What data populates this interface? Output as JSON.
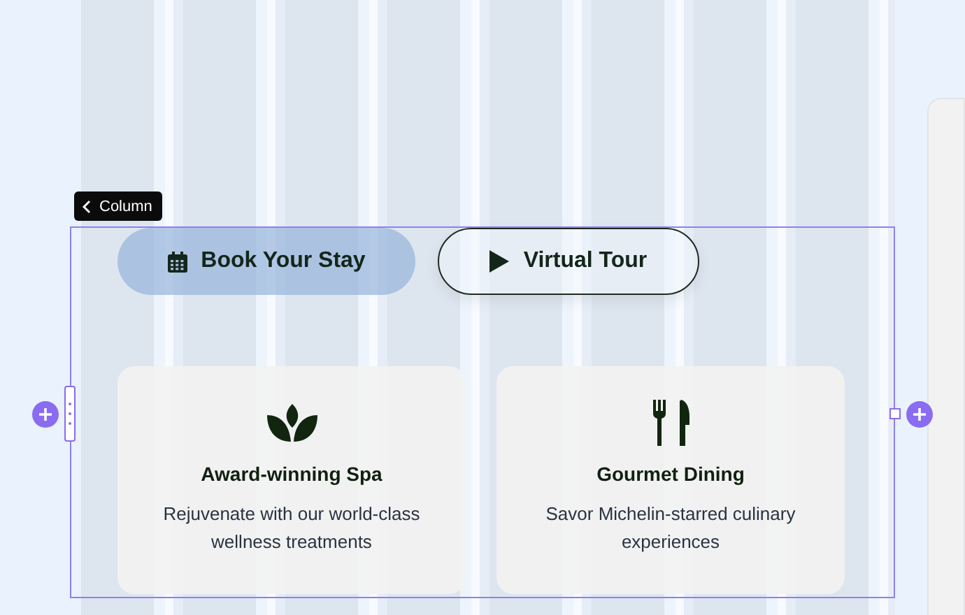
{
  "column_tag": {
    "label": "Column"
  },
  "buttons": [
    {
      "label": "Book Your Stay",
      "kind": "primary"
    },
    {
      "label": "Virtual Tour",
      "kind": "outline"
    }
  ],
  "features": [
    {
      "title": "Award-winning Spa",
      "description": "Rejuvenate with our world-class wellness treatments"
    },
    {
      "title": "Gourmet Dining",
      "description": "Savor Michelin-starred culinary experiences"
    }
  ]
}
